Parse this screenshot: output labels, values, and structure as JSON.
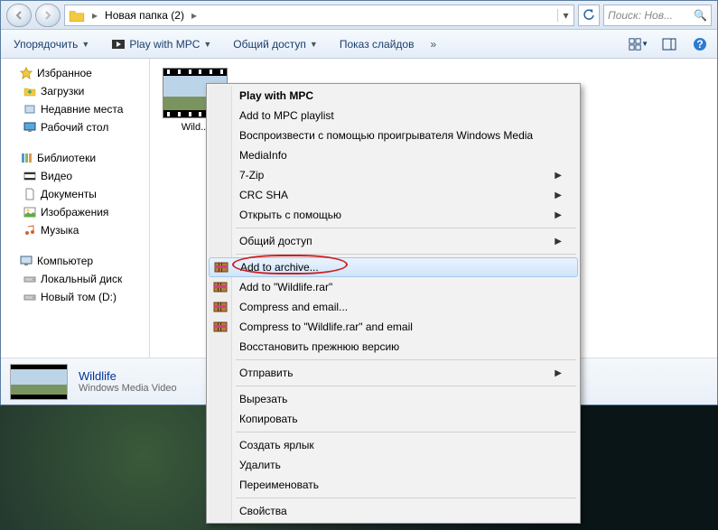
{
  "titlebar": {
    "breadcrumb_text": "Новая папка (2)",
    "search_placeholder": "Поиск: Нов..."
  },
  "toolbar": {
    "organize": "Упорядочить",
    "play_mpc": "Play with MPC",
    "share": "Общий доступ",
    "slideshow": "Показ слайдов"
  },
  "sidebar": {
    "favorites": "Избранное",
    "fav_items": [
      "Загрузки",
      "Недавние места",
      "Рабочий стол"
    ],
    "libraries": "Библиотеки",
    "lib_items": [
      "Видео",
      "Документы",
      "Изображения",
      "Музыка"
    ],
    "computer": "Компьютер",
    "comp_items": [
      "Локальный диск",
      "Новый том (D:)"
    ]
  },
  "content": {
    "file_label": "Wild..."
  },
  "details": {
    "title": "Wildlife",
    "subtitle": "Windows Media Video"
  },
  "context_menu": {
    "items": [
      {
        "label": "Play with MPC",
        "bold": true
      },
      {
        "label": "Add to MPC playlist"
      },
      {
        "label": "Воспроизвести с помощью проигрывателя Windows Media"
      },
      {
        "label": "MediaInfo"
      },
      {
        "label": "7-Zip",
        "submenu": true
      },
      {
        "label": "CRC SHA",
        "submenu": true
      },
      {
        "label": "Открыть с помощью",
        "submenu": true
      },
      {
        "sep": true
      },
      {
        "label": "Общий доступ",
        "submenu": true
      },
      {
        "sep": true
      },
      {
        "label": "Add to archive...",
        "icon": "winrar",
        "highlight": true
      },
      {
        "label": "Add to \"Wildlife.rar\"",
        "icon": "winrar"
      },
      {
        "label": "Compress and email...",
        "icon": "winrar"
      },
      {
        "label": "Compress to \"Wildlife.rar\" and email",
        "icon": "winrar"
      },
      {
        "label": "Восстановить прежнюю версию"
      },
      {
        "sep": true
      },
      {
        "label": "Отправить",
        "submenu": true
      },
      {
        "sep": true
      },
      {
        "label": "Вырезать"
      },
      {
        "label": "Копировать"
      },
      {
        "sep": true
      },
      {
        "label": "Создать ярлык"
      },
      {
        "label": "Удалить"
      },
      {
        "label": "Переименовать"
      },
      {
        "sep": true
      },
      {
        "label": "Свойства"
      }
    ]
  }
}
